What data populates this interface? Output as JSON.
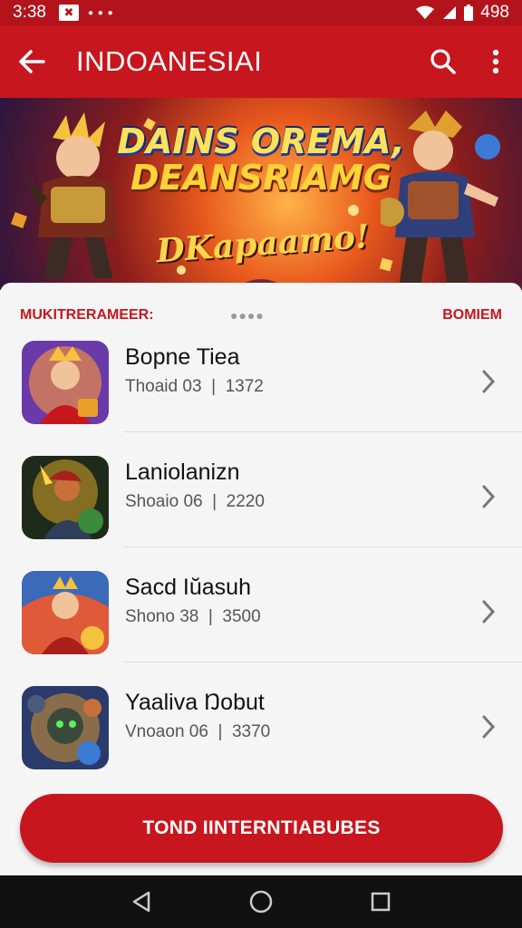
{
  "status_bar": {
    "time": "3:38",
    "notification_glyph": "✖",
    "dots": "● ● ●",
    "battery_text": "498",
    "icons": [
      "wifi-icon",
      "signal-icon",
      "battery-icon"
    ]
  },
  "app_bar": {
    "title": "INDOANESIAI",
    "icons": [
      "back-arrow-icon",
      "search-icon",
      "more-vert-icon"
    ]
  },
  "banner": {
    "line1": "DAINS OREMA,",
    "line2": "DEANSRIAMG",
    "line3": "DKapaamo!"
  },
  "section": {
    "left_label": "MUKITRERAMEER:",
    "middle_text": "●●●●",
    "right_label": "BOMIEM"
  },
  "games": [
    {
      "name": "Bopne Tiea",
      "meta_left": "Thoaid 03",
      "meta_right": "1372",
      "icon": "game-thumb-warrior"
    },
    {
      "name": "Laniolanizn",
      "meta_left": "Shoaio 06",
      "meta_right": "2220",
      "icon": "game-thumb-hero"
    },
    {
      "name": "Sacd Iŭasuh",
      "meta_left": "Shono 38",
      "meta_right": "3500",
      "icon": "game-thumb-queen"
    },
    {
      "name": "Yaaliva Ŋobut",
      "meta_left": "Vnoaon 06",
      "meta_right": "3370",
      "icon": "game-thumb-knight"
    }
  ],
  "cta": {
    "label": "TOND IINTERNTIABUBES"
  },
  "nav_bar": {
    "icons": [
      "back-triangle-icon",
      "home-circle-icon",
      "recents-square-icon"
    ]
  },
  "colors": {
    "primary": "#c8161e",
    "status_bar": "#b3141c",
    "background": "#f5f5f5"
  }
}
